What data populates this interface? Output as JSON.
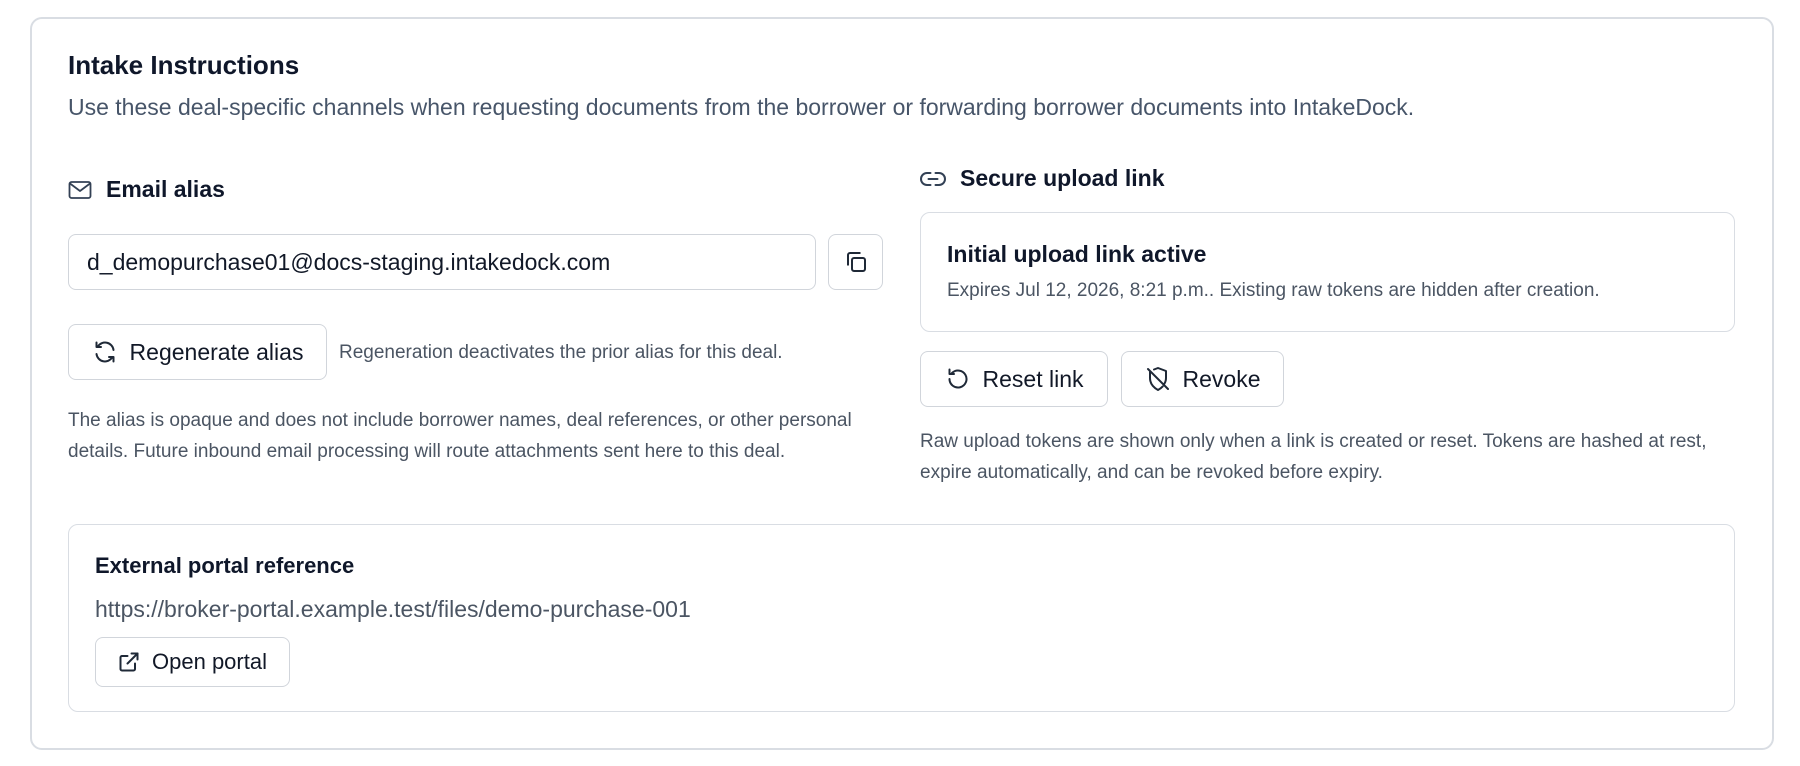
{
  "panel": {
    "title": "Intake Instructions",
    "subtitle": "Use these deal-specific channels when requesting documents from the borrower or forwarding borrower documents into IntakeDock."
  },
  "email_section": {
    "heading": "Email alias",
    "icon": "mail-icon",
    "alias_value": "d_demopurchase01@docs-staging.intakedock.com",
    "copy_icon": "copy-icon",
    "regenerate_label": "Regenerate alias",
    "regenerate_icon": "refresh-icon",
    "regenerate_note": "Regeneration deactivates the prior alias for this deal.",
    "description_line1": "The alias is opaque and does not include borrower names, deal references, or other personal",
    "description_line2": "details. Future inbound email processing will route attachments sent here to this deal."
  },
  "upload_section": {
    "heading": "Secure upload link",
    "icon": "link-icon",
    "status_title": "Initial upload link active",
    "status_text": "Expires Jul 12, 2026, 8:21 p.m.. Existing raw tokens are hidden after creation.",
    "reset_label": "Reset link",
    "reset_icon": "rotate-ccw-icon",
    "revoke_label": "Revoke",
    "revoke_icon": "shield-off-icon",
    "description_line1": "Raw upload tokens are shown only when a link is created or reset. Tokens are hashed at rest,",
    "description_line2": "expire automatically, and can be revoked before expiry."
  },
  "portal_section": {
    "heading": "External portal reference",
    "url": "https://broker-portal.example.test/files/demo-purchase-001",
    "open_label": "Open portal",
    "open_icon": "external-link-icon"
  },
  "colors": {
    "text_primary": "#0f172a",
    "text_muted": "#4b5563",
    "border": "#d9dde3"
  }
}
